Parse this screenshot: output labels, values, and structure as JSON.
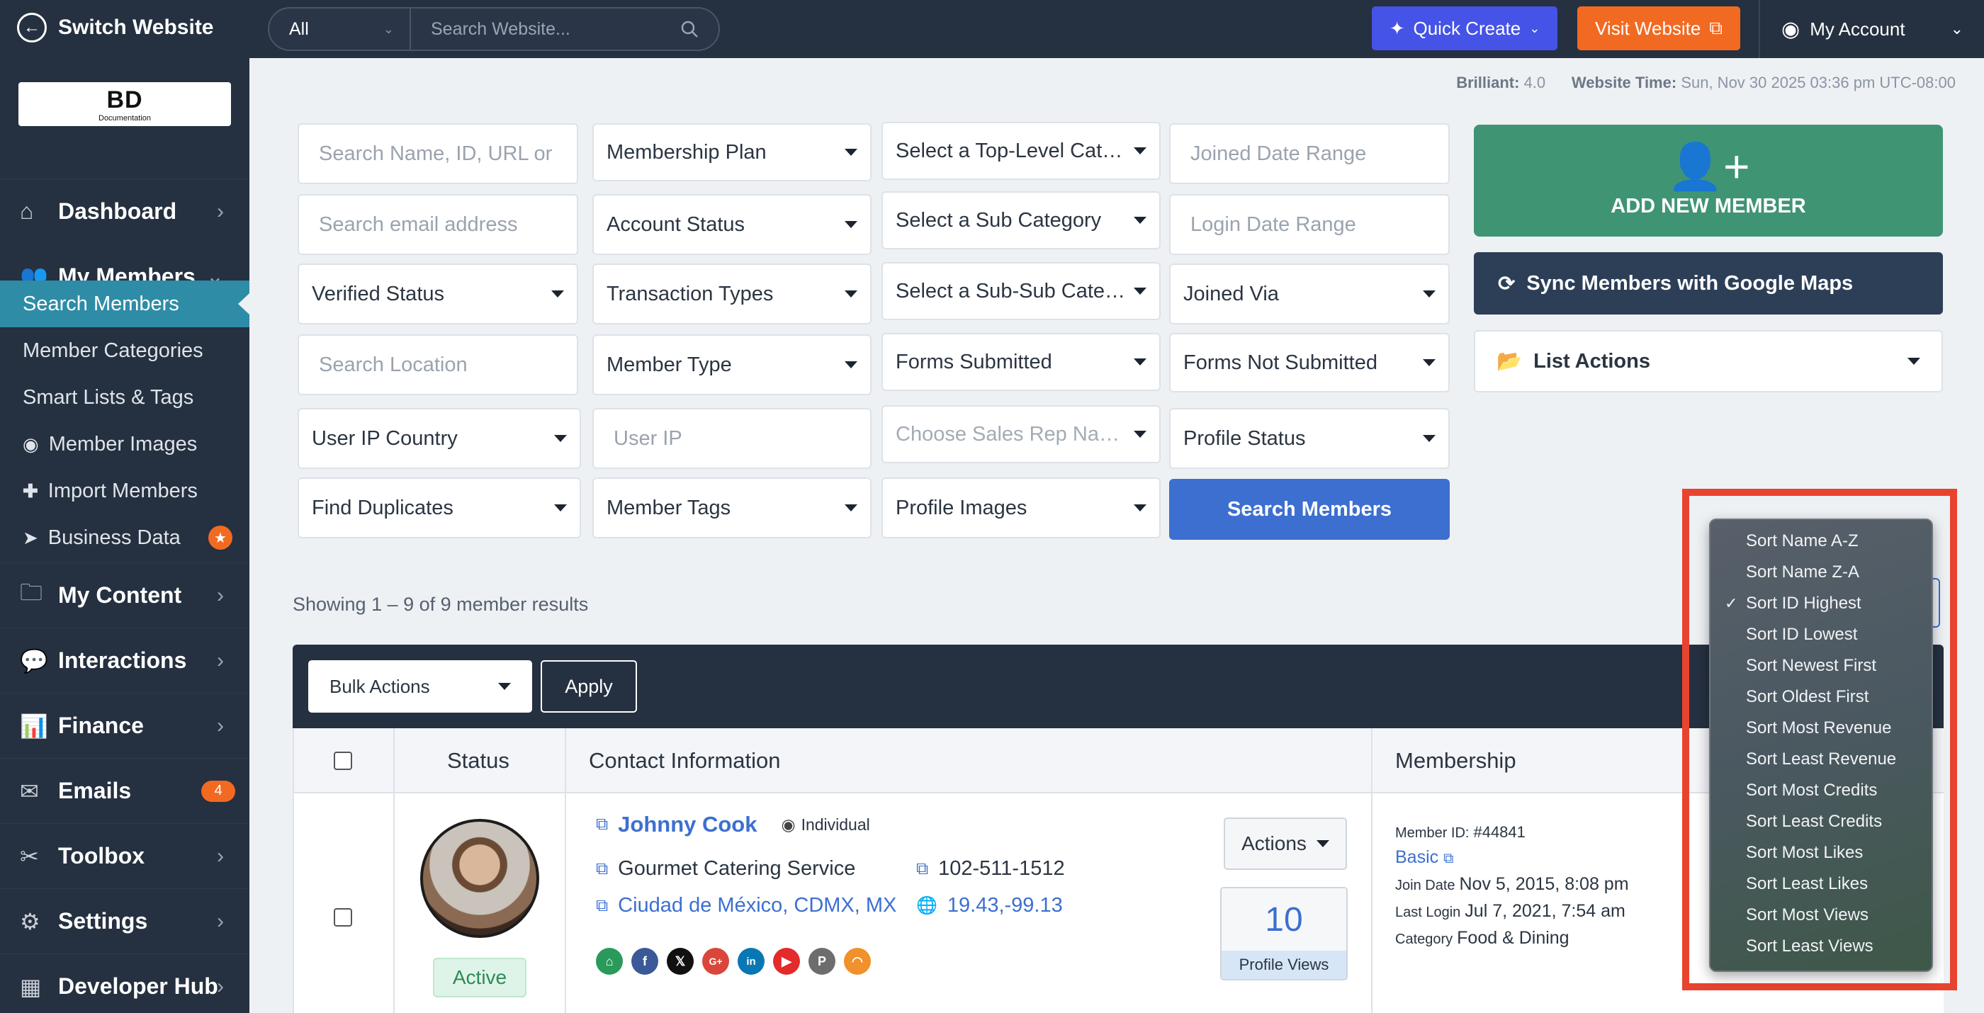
{
  "topbar": {
    "switch_label": "Switch Website",
    "search_scope": "All",
    "search_placeholder": "Search Website...",
    "quick_create": "Quick Create",
    "visit_website": "Visit Website",
    "my_account": "My Account"
  },
  "logo": {
    "text": "BD",
    "sub": "Documentation"
  },
  "sidebar": {
    "items": [
      {
        "label": "Dashboard"
      },
      {
        "label": "My Members"
      },
      {
        "label": "My Content"
      },
      {
        "label": "Interactions"
      },
      {
        "label": "Finance"
      },
      {
        "label": "Emails",
        "badge": "4"
      },
      {
        "label": "Toolbox"
      },
      {
        "label": "Settings"
      },
      {
        "label": "Developer Hub"
      }
    ],
    "sub_items": [
      {
        "label": "Search Members"
      },
      {
        "label": "Member Categories"
      },
      {
        "label": "Smart Lists & Tags"
      },
      {
        "label": "Member Images"
      },
      {
        "label": "Import Members"
      },
      {
        "label": "Business Data"
      }
    ]
  },
  "info": {
    "brilliant_label": "Brilliant:",
    "brilliant_value": "4.0",
    "time_label": "Website Time:",
    "time_value": "Sun, Nov 30 2025 03:36 pm UTC-08:00"
  },
  "filters": {
    "search_name": "Search Name, ID, URL or",
    "search_email": "Search email address",
    "verified_status": "Verified Status",
    "search_location": "Search Location",
    "user_ip_country": "User IP Country",
    "find_duplicates": "Find Duplicates",
    "membership_plan": "Membership Plan",
    "account_status": "Account Status",
    "transaction_types": "Transaction Types",
    "member_type": "Member Type",
    "user_ip": "User IP",
    "member_tags": "Member Tags",
    "top_level_cat": "Select a Top-Level Category",
    "sub_category": "Select a Sub Category",
    "sub_sub_cat": "Select a Sub-Sub Category",
    "forms_submitted": "Forms Submitted",
    "sales_rep": "Choose Sales Rep Name",
    "profile_images": "Profile Images",
    "joined_date": "Joined Date Range",
    "login_date": "Login Date Range",
    "joined_via": "Joined Via",
    "forms_not_submitted": "Forms Not Submitted",
    "profile_status": "Profile Status",
    "search_button": "Search Members"
  },
  "actions_panel": {
    "add_member": "ADD NEW MEMBER",
    "sync": "Sync Members with Google Maps",
    "list_actions": "List Actions"
  },
  "results_text": "Showing 1 – 9 of 9 member results",
  "bulk": {
    "label": "Bulk Actions",
    "apply": "Apply"
  },
  "table": {
    "headers": {
      "status": "Status",
      "contact": "Contact Information",
      "membership": "Membership"
    },
    "row": {
      "status": "Active",
      "name": "Johnny Cook",
      "type": "Individual",
      "company": "Gourmet Catering Service",
      "phone": "102-511-1512",
      "location": "Ciudad de México, CDMX, MX",
      "coords": "19.43,-99.13",
      "actions": "Actions",
      "views": "10",
      "views_label": "Profile Views",
      "member_id_label": "Member ID:",
      "member_id": "#44841",
      "plan": "Basic",
      "join_label": "Join Date",
      "join_date": "Nov 5, 2015, 8:08 pm",
      "login_label": "Last Login",
      "login_date": "Jul 7, 2021, 7:54 am",
      "category_label": "Category",
      "category": "Food & Dining"
    }
  },
  "sort_menu": {
    "selected": "Sort ID Highest",
    "options": [
      "Sort Name A-Z",
      "Sort Name Z-A",
      "Sort ID Highest",
      "Sort ID Lowest",
      "Sort Newest First",
      "Sort Oldest First",
      "Sort Most Revenue",
      "Sort Least Revenue",
      "Sort Most Credits",
      "Sort Least Credits",
      "Sort Most Likes",
      "Sort Least Likes",
      "Sort Most Views",
      "Sort Least Views"
    ]
  },
  "colors": {
    "sidebar": "#253040",
    "accent_blue": "#3c6fd0",
    "green": "#3f9474",
    "orange": "#f26a21",
    "highlight_red": "#e8432e"
  }
}
